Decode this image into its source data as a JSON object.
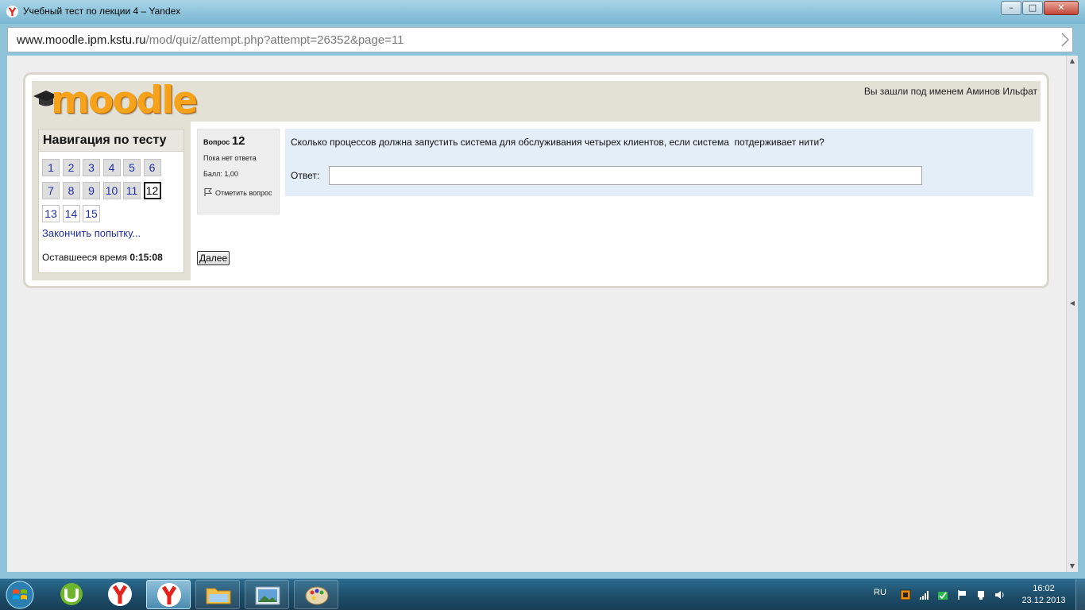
{
  "window": {
    "title": "Учебный тест по лекции 4 – Yandex",
    "controls": {
      "minimize": "–",
      "maximize": "□",
      "close": "✕"
    }
  },
  "address": {
    "host": "www.moodle.ipm.kstu.ru",
    "path": "/mod/quiz/attempt.php?attempt=26352&page=11"
  },
  "header": {
    "logo": "moodle",
    "logged_in": "Вы зашли под именем Аминов Ильфат"
  },
  "nav": {
    "title": "Навигация по тесту",
    "questions": [
      {
        "label": "1",
        "state": "answered"
      },
      {
        "label": "2",
        "state": "answered"
      },
      {
        "label": "3",
        "state": "answered"
      },
      {
        "label": "4",
        "state": "answered"
      },
      {
        "label": "5",
        "state": "answered"
      },
      {
        "label": "6",
        "state": "answered"
      },
      {
        "label": "7",
        "state": "answered"
      },
      {
        "label": "8",
        "state": "answered"
      },
      {
        "label": "9",
        "state": "answered"
      },
      {
        "label": "10",
        "state": "answered"
      },
      {
        "label": "11",
        "state": "answered"
      },
      {
        "label": "12",
        "state": "current"
      },
      {
        "label": "13",
        "state": "unseen"
      },
      {
        "label": "14",
        "state": "unseen"
      },
      {
        "label": "15",
        "state": "unseen"
      }
    ],
    "finish": "Закончить попытку...",
    "time_left_label": "Оставшееся время",
    "time_left": "0:15:08"
  },
  "question": {
    "prefix": "Вопрос",
    "number": "12",
    "state": "Пока нет ответа",
    "grade": "Балл: 1,00",
    "flag": "Отметить вопрос",
    "text": "Сколько процессов должна запустить система для обслуживания четырех клиентов, если система  потдерживает нити?",
    "answer_label": "Ответ:",
    "answer_value": ""
  },
  "next_button": "Далее",
  "taskbar": {
    "language": "RU",
    "time": "16:02",
    "date": "23.12.2013"
  },
  "colors": {
    "logo": "#f7a21b",
    "link": "#1f2fa7",
    "question_bg": "#e3eef8",
    "header_bg": "#e3e0d6"
  }
}
